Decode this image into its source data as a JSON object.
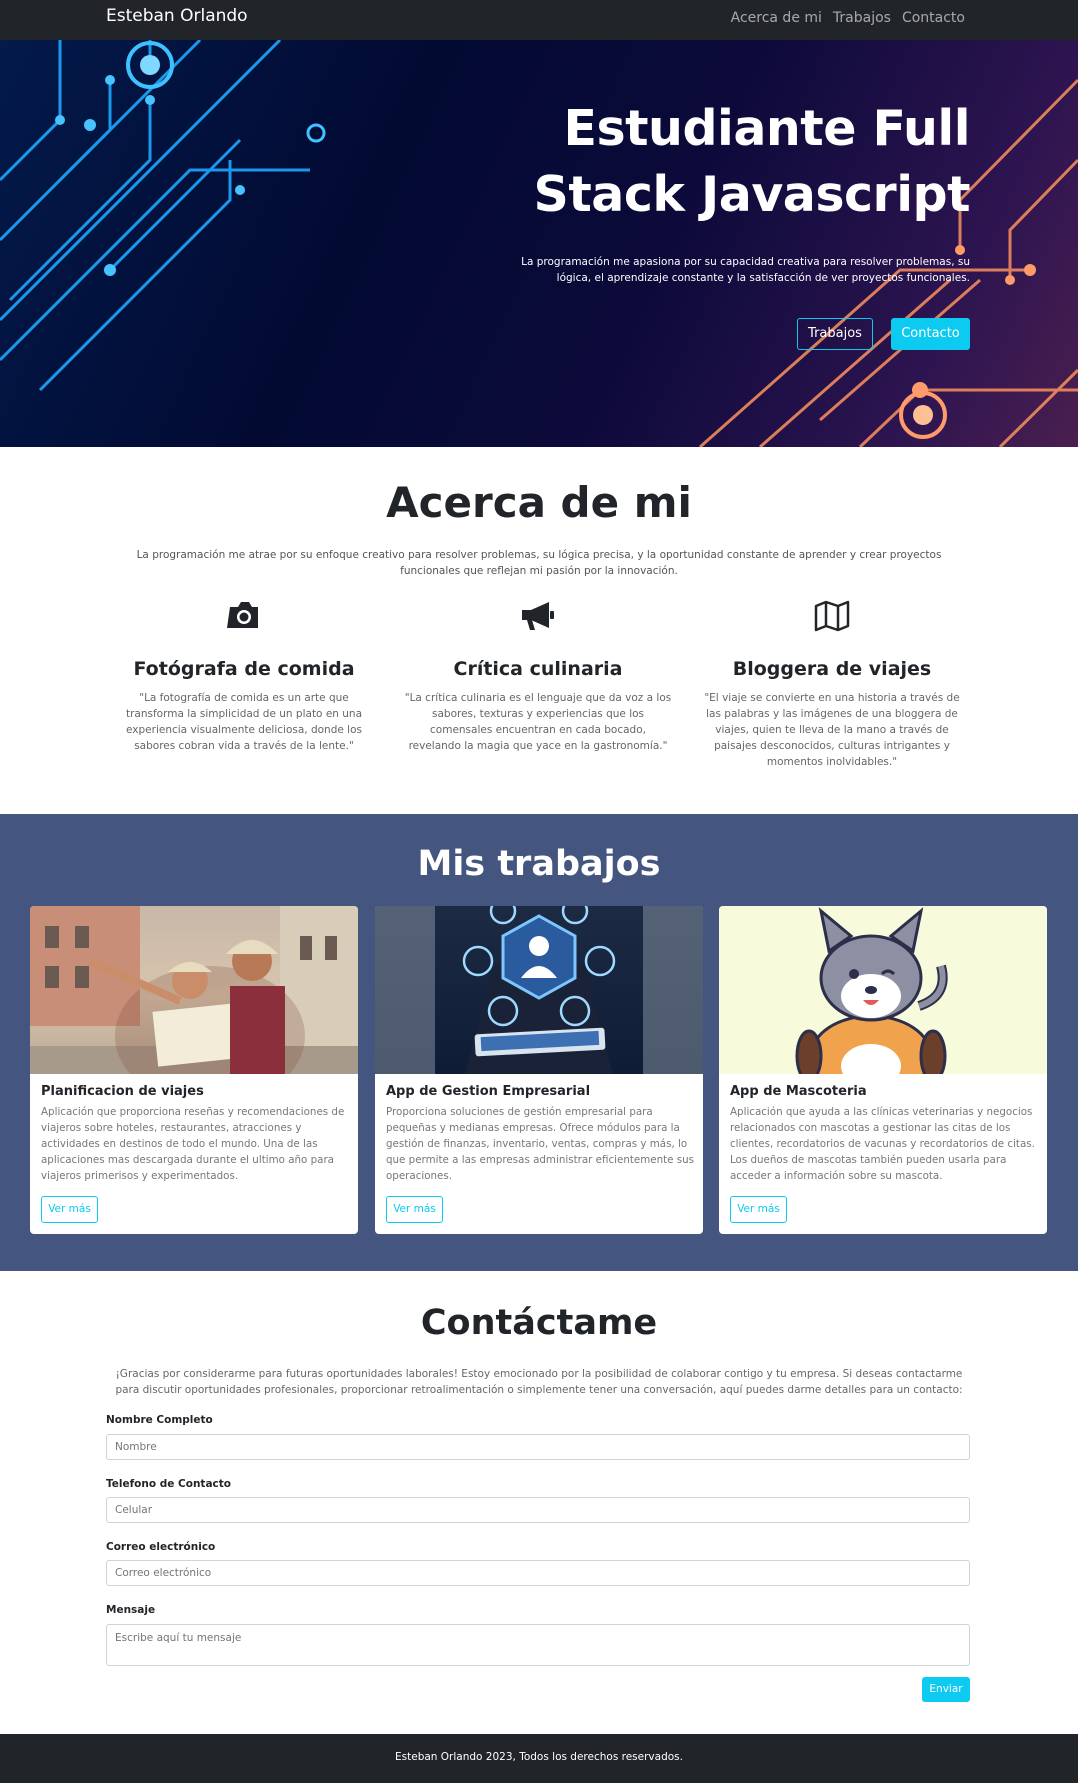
{
  "nav": {
    "brand": "Esteban Orlando",
    "links": [
      "Acerca de mi",
      "Trabajos",
      "Contacto"
    ]
  },
  "hero": {
    "title": "Estudiante Full Stack Javascript",
    "subtitle": "La programación me apasiona por su capacidad creativa para resolver problemas, su lógica, el aprendizaje constante y la satisfacción de ver proyectos funcionales.",
    "btn_works": "Trabajos",
    "btn_contact": "Contacto"
  },
  "about": {
    "title": "Acerca de mi",
    "text": "La programación me atrae por su enfoque creativo para resolver problemas, su lógica precisa, y la oportunidad constante de aprender y crear proyectos funcionales que reflejan mi pasión por la innovación.",
    "features": [
      {
        "icon": "camera-icon",
        "title": "Fotógrafa de comida",
        "text": "\"La fotografía de comida es un arte que transforma la simplicidad de un plato en una experiencia visualmente deliciosa, donde los sabores cobran vida a través de la lente.\""
      },
      {
        "icon": "megaphone-icon",
        "title": "Crítica culinaria",
        "text": "\"La crítica culinaria es el lenguaje que da voz a los sabores, texturas y experiencias que los comensales encuentran en cada bocado, revelando la magia que yace en la gastronomía.\""
      },
      {
        "icon": "map-icon",
        "title": "Bloggera de viajes",
        "text": "\"El viaje se convierte en una historia a través de las palabras y las imágenes de una bloggera de viajes, quien te lleva de la mano a través de paisajes desconocidos, culturas intrigantes y momentos inolvidables.\""
      }
    ]
  },
  "works": {
    "title": "Mis trabajos",
    "more_label": "Ver más",
    "cards": [
      {
        "title": "Planificacion de viajes",
        "text": "Aplicación que proporciona reseñas y recomendaciones de viajeros sobre hoteles, restaurantes, atracciones y actividades en destinos de todo el mundo. Una de las aplicaciones mas descargada durante el ultimo año para viajeros primerisos y experimentados."
      },
      {
        "title": "App de Gestion Empresarial",
        "text": "Proporciona soluciones de gestión empresarial para pequeñas y medianas empresas. Ofrece módulos para la gestión de finanzas, inventario, ventas, compras y más, lo que permite a las empresas administrar eficientemente sus operaciones."
      },
      {
        "title": "App de Mascoteria",
        "text": "Aplicación que ayuda a las clínicas veterinarias y negocios relacionados con mascotas a gestionar las citas de los clientes, recordatorios de vacunas y recordatorios de citas. Los dueños de mascotas también pueden usarla para acceder a información sobre su mascota."
      }
    ]
  },
  "contact": {
    "title": "Contáctame",
    "text": "¡Gracias por considerarme para futuras oportunidades laborales! Estoy emocionado por la posibilidad de colaborar contigo y tu empresa. Si deseas contactarme para discutir oportunidades profesionales, proporcionar retroalimentación o simplemente tener una conversación, aquí puedes darme detalles para un contacto:",
    "fields": [
      {
        "label": "Nombre Completo",
        "placeholder": "Nombre"
      },
      {
        "label": "Telefono de Contacto",
        "placeholder": "Celular"
      },
      {
        "label": "Correo electrónico",
        "placeholder": "Correo electrónico"
      },
      {
        "label": "Mensaje",
        "placeholder": "Escribe aquí tu mensaje"
      }
    ],
    "submit": "Enviar"
  },
  "footer": {
    "text": "Esteban Orlando 2023, Todos los derechos reservados."
  },
  "colors": {
    "accent": "#0dcaf0",
    "dark": "#212529",
    "works_bg": "#44567f"
  }
}
